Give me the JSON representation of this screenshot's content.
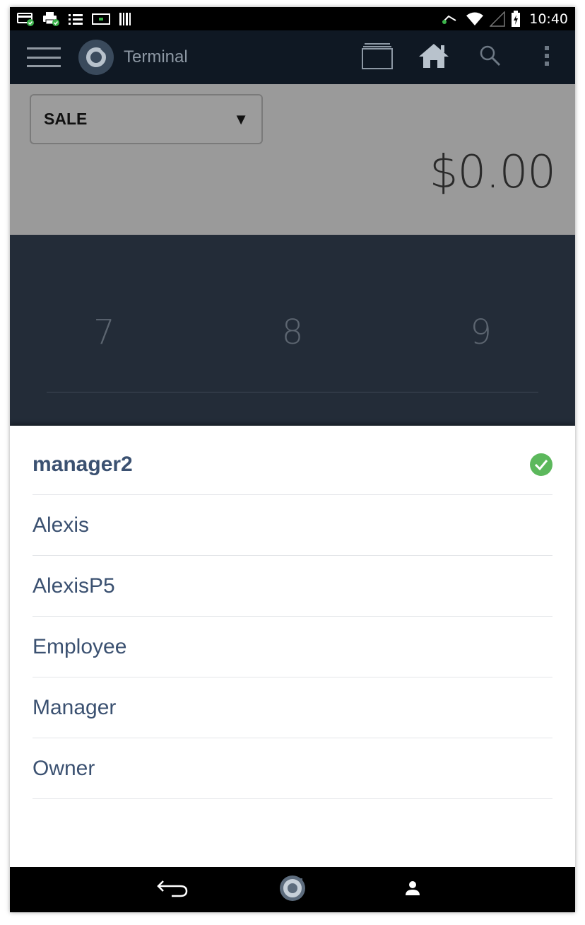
{
  "status_bar": {
    "time": "10:40",
    "icons": [
      "card-icon",
      "printer-icon",
      "list-icon",
      "screen-icon",
      "barcode-icon",
      "usb-icon",
      "wifi-icon",
      "signal-icon",
      "battery-charging-icon"
    ]
  },
  "app_bar": {
    "title": "Terminal",
    "actions": [
      "cards-icon",
      "home-icon",
      "search-icon",
      "more-vert-icon"
    ]
  },
  "transaction": {
    "type_selected": "SALE",
    "amount": "$0.00"
  },
  "keypad": {
    "keys": [
      "7",
      "8",
      "9"
    ]
  },
  "user_list": {
    "selected": "manager2",
    "items": [
      "manager2",
      "Alexis",
      "AlexisP5",
      "Employee",
      "Manager",
      "Owner"
    ]
  },
  "nav_bar": {
    "buttons": [
      "back-icon",
      "clover-home-icon",
      "account-icon"
    ]
  },
  "colors": {
    "app_bar": "#0f1823",
    "content_bg": "#9a9a9a",
    "keypad_bg": "#232c38",
    "user_text": "#3b5171",
    "check_green": "#5cb85c"
  }
}
